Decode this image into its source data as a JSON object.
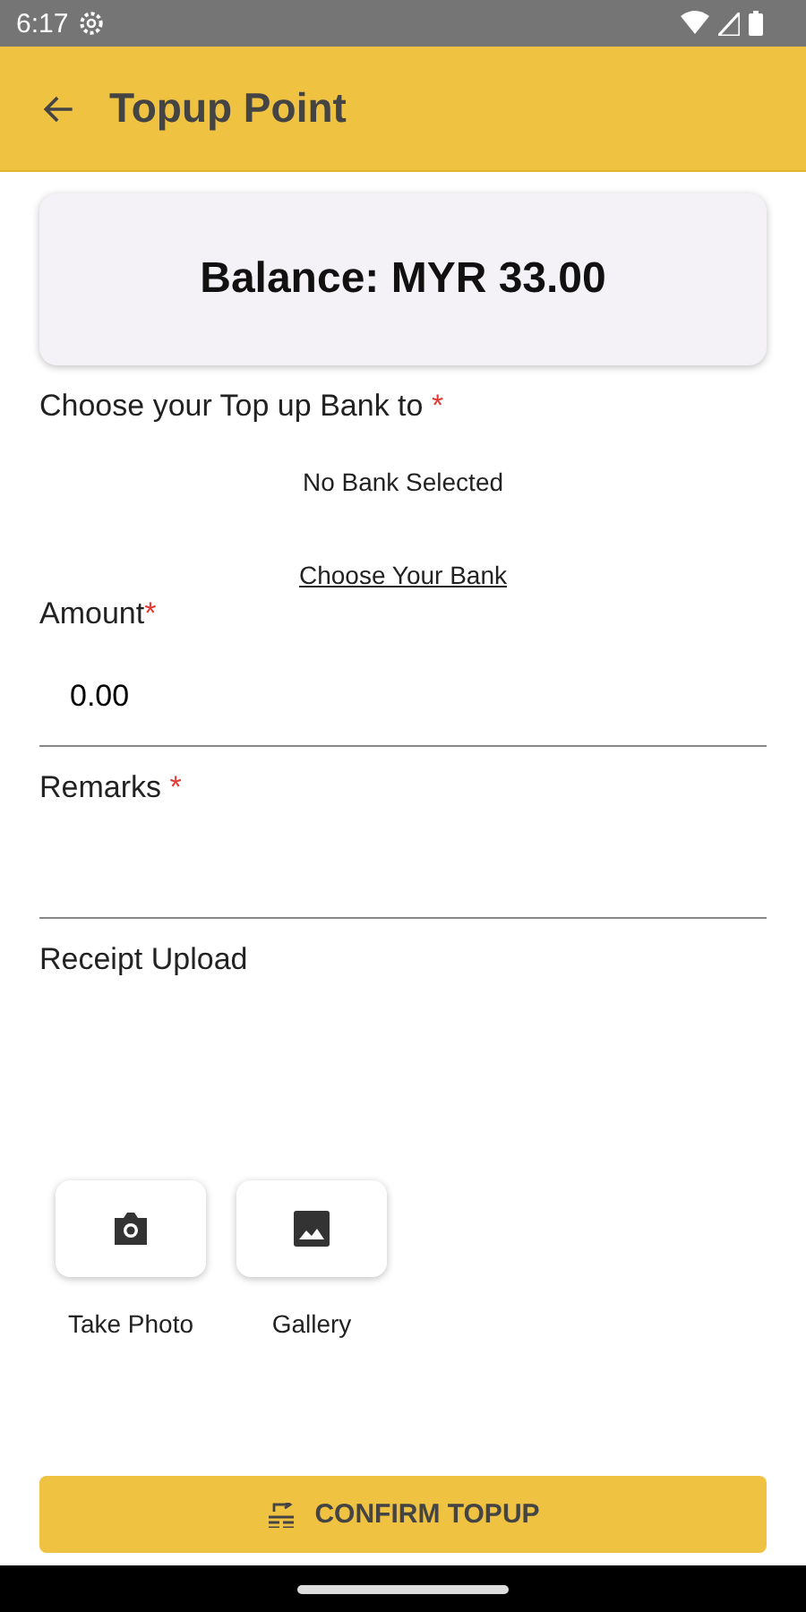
{
  "status_bar": {
    "time": "6:17"
  },
  "app_bar": {
    "title": "Topup Point"
  },
  "balance": {
    "text": "Balance: MYR 33.00"
  },
  "bank": {
    "label": "Choose your Top up Bank to",
    "mark": " *",
    "status": "No Bank Selected",
    "link": "Choose Your Bank"
  },
  "amount": {
    "label": "Amount",
    "mark": "*",
    "value": "0.00"
  },
  "remarks": {
    "label": "Remarks",
    "mark": " *"
  },
  "receipt": {
    "label": "Receipt Upload",
    "options": [
      {
        "kind": "camera",
        "label": "Take Photo"
      },
      {
        "kind": "gallery",
        "label": "Gallery"
      }
    ]
  },
  "confirm_button": {
    "label": "CONFIRM TOPUP"
  }
}
